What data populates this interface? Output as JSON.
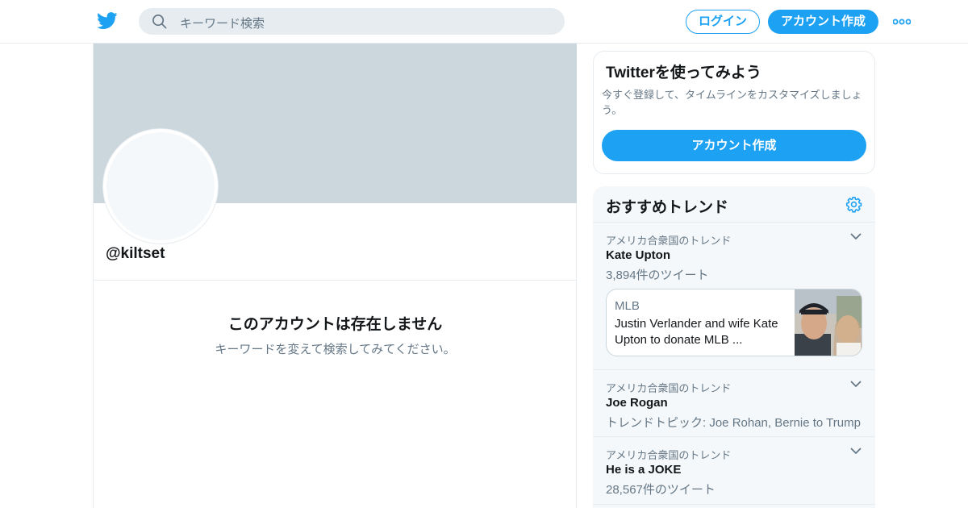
{
  "header": {
    "search_placeholder": "キーワード検索",
    "login_label": "ログイン",
    "signup_label": "アカウント作成"
  },
  "profile": {
    "handle": "@kiltset",
    "empty_title": "このアカウントは存在しません",
    "empty_subtitle": "キーワードを変えて検索してみてください。"
  },
  "signup_card": {
    "title": "Twitterを使ってみよう",
    "description": "今すぐ登録して、タイムラインをカスタマイズしましょう。",
    "button_label": "アカウント作成"
  },
  "trends": {
    "title": "おすすめトレンド",
    "items": [
      {
        "context": "アメリカ合衆国のトレンド",
        "name": "Kate Upton",
        "meta": "3,894件のツイート",
        "news": {
          "source": "MLB",
          "headline": "Justin Verlander and wife Kate Upton to donate MLB ..."
        }
      },
      {
        "context": "アメリカ合衆国のトレンド",
        "name": "Joe Rogan",
        "meta": "トレンドトピック: Joe Rohan, Bernie to Trump"
      },
      {
        "context": "アメリカ合衆国のトレンド",
        "name": "He is a JOKE",
        "meta": "28,567件のツイート"
      }
    ]
  },
  "colors": {
    "accent": "#1da1f2",
    "banner": "#ccd6dd",
    "secondary_text": "#657786",
    "trends_background": "#f5f8fa"
  },
  "icons": [
    "twitter-bird-icon",
    "search-icon",
    "more-icon",
    "gear-icon",
    "chevron-down-icon"
  ]
}
